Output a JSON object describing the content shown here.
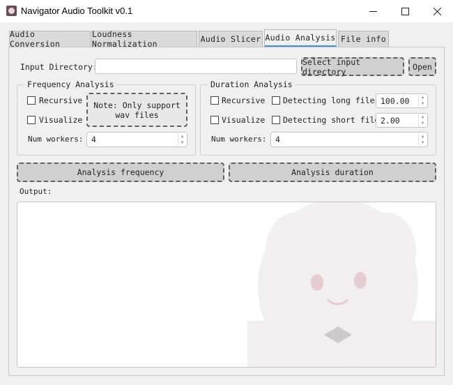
{
  "window": {
    "title": "Navigator Audio Toolkit v0.1"
  },
  "tabs": [
    {
      "label": "Audio Conversion"
    },
    {
      "label": "Loudness Normalization"
    },
    {
      "label": "Audio Slicer"
    },
    {
      "label": "Audio Analysis"
    },
    {
      "label": "File info"
    }
  ],
  "active_tab": "Audio Analysis",
  "input_directory": {
    "label": "Input Directory:",
    "value": "",
    "select_button": "Select input directory",
    "open_button": "Open"
  },
  "frequency_analysis": {
    "title": "Frequency Analysis",
    "recursive_label": "Recursive",
    "recursive_checked": false,
    "visualize_label": "Visualize",
    "visualize_checked": false,
    "note": "Note: Only support\nwav files",
    "num_workers_label": "Num workers:",
    "num_workers_value": "4"
  },
  "duration_analysis": {
    "title": "Duration Analysis",
    "recursive_label": "Recursive",
    "recursive_checked": false,
    "visualize_label": "Visualize",
    "visualize_checked": false,
    "long_files_label": "Detecting long files",
    "long_files_checked": false,
    "long_files_value": "100.00",
    "short_files_label": "Detecting short files",
    "short_files_checked": false,
    "short_files_value": "2.00",
    "num_workers_label": "Num workers:",
    "num_workers_value": "4"
  },
  "actions": {
    "analysis_frequency": "Analysis frequency",
    "analysis_duration": "Analysis duration"
  },
  "output": {
    "label": "Output:",
    "text": ""
  }
}
